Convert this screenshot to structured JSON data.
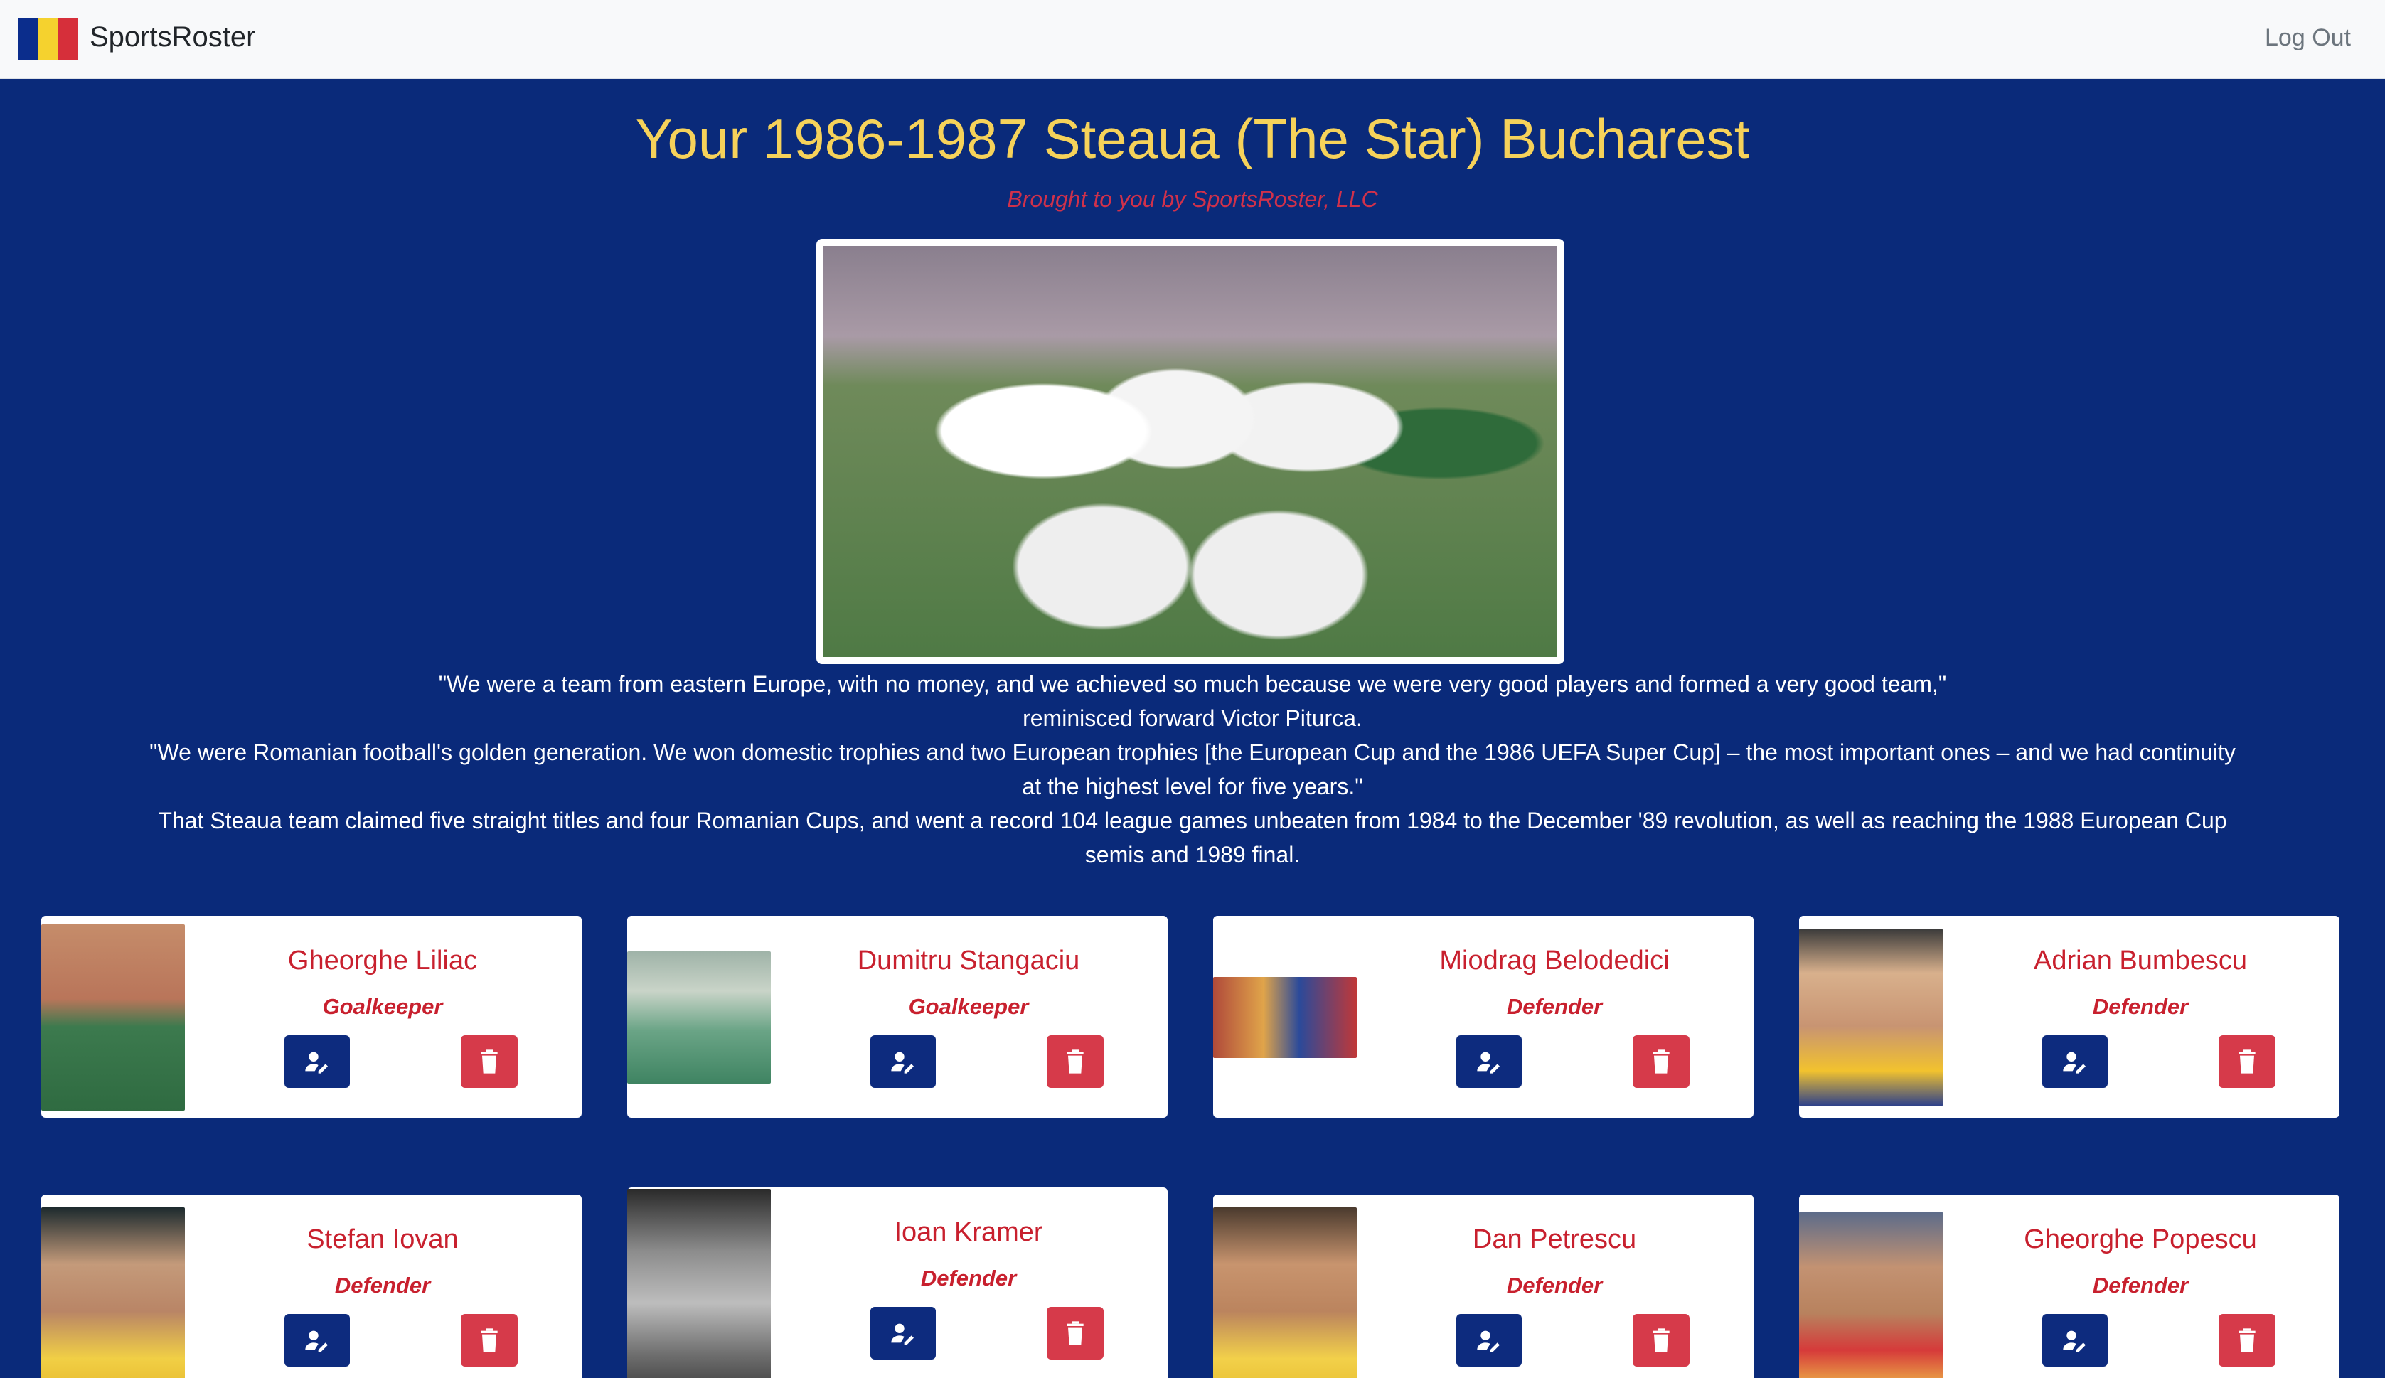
{
  "nav": {
    "brand": "SportsRoster",
    "logout_label": "Log Out",
    "flag_colors": [
      "#0b2d8c",
      "#f5d22e",
      "#d62f3a"
    ]
  },
  "header": {
    "title": "Your 1986-1987 Steaua (The Star) Bucharest",
    "subtitle": "Brought to you by SportsRoster, LLC"
  },
  "quote": {
    "line1": "\"We were a team from eastern Europe, with no money, and we achieved so much because we were very good players and formed a very good team,\"",
    "line2": "reminisced forward Victor Piturca.",
    "line3": "\"We were Romanian football's golden generation. We won domestic trophies and two European trophies [the European Cup and the 1986 UEFA Super Cup] – the most important ones – and we had continuity at the highest level for five years.\"",
    "line4": "That Steaua team claimed five straight titles and four Romanian Cups, and went a record 104 league games unbeaten from 1984 to the December '89 revolution, as well as reaching the 1988 European Cup semis and 1989 final."
  },
  "players": [
    {
      "name": "Gheorghe Liliac",
      "position": "Goalkeeper"
    },
    {
      "name": "Dumitru Stangaciu",
      "position": "Goalkeeper"
    },
    {
      "name": "Miodrag Belodedici",
      "position": "Defender"
    },
    {
      "name": "Adrian Bumbescu",
      "position": "Defender"
    },
    {
      "name": "Stefan Iovan",
      "position": "Defender"
    },
    {
      "name": "Ioan Kramer",
      "position": "Defender"
    },
    {
      "name": "Dan Petrescu",
      "position": "Defender"
    },
    {
      "name": "Gheorghe Popescu",
      "position": "Defender"
    }
  ],
  "colors": {
    "background": "#0a2a7a",
    "title": "#f6d25a",
    "accent_red": "#c8202e",
    "edit_button": "#0d2b7e",
    "delete_button": "#d63a4a"
  },
  "icons": {
    "edit": "user-edit-icon",
    "delete": "trash-icon"
  }
}
